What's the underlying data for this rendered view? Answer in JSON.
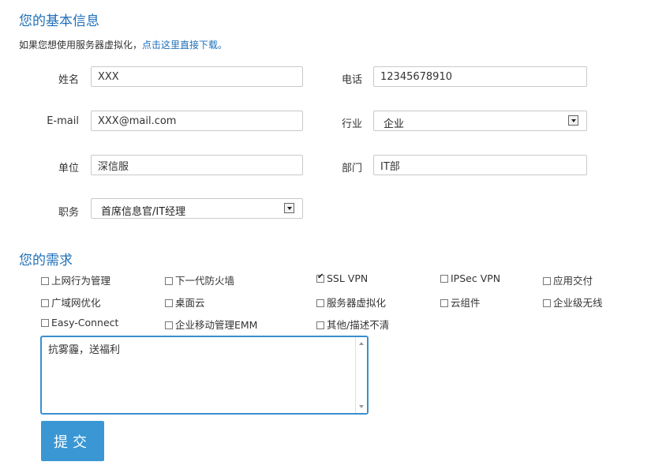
{
  "basic_section": {
    "title": "您的基本信息",
    "intro_text": "如果您想使用服务器虚拟化，",
    "intro_link": "点击这里直接下载。"
  },
  "form": {
    "name": {
      "label": "姓名",
      "value": "XXX"
    },
    "phone": {
      "label": "电话",
      "value": "12345678910"
    },
    "email": {
      "label": "E-mail",
      "value": "XXX@mail.com"
    },
    "industry": {
      "label": "行业",
      "selected": "企业"
    },
    "company": {
      "label": "单位",
      "value": "深信服"
    },
    "department": {
      "label": "部门",
      "value": "IT部"
    },
    "position": {
      "label": "职务",
      "selected": "首席信息官/IT经理"
    }
  },
  "needs_section": {
    "title": "您的需求",
    "options": [
      {
        "label": "上网行为管理",
        "checked": false
      },
      {
        "label": "下一代防火墙",
        "checked": false
      },
      {
        "label": "SSL VPN",
        "checked": true
      },
      {
        "label": "IPSec VPN",
        "checked": false
      },
      {
        "label": "应用交付",
        "checked": false
      },
      {
        "label": "广域网优化",
        "checked": false
      },
      {
        "label": "桌面云",
        "checked": false
      },
      {
        "label": "服务器虚拟化",
        "checked": false
      },
      {
        "label": "云组件",
        "checked": false
      },
      {
        "label": "企业级无线",
        "checked": false
      },
      {
        "label": "Easy-Connect",
        "checked": false
      },
      {
        "label": "企业移动管理EMM",
        "checked": false
      },
      {
        "label": "其他/描述不清",
        "checked": false
      }
    ],
    "description": "抗雾霾，送福利"
  },
  "submit_label": "提交"
}
